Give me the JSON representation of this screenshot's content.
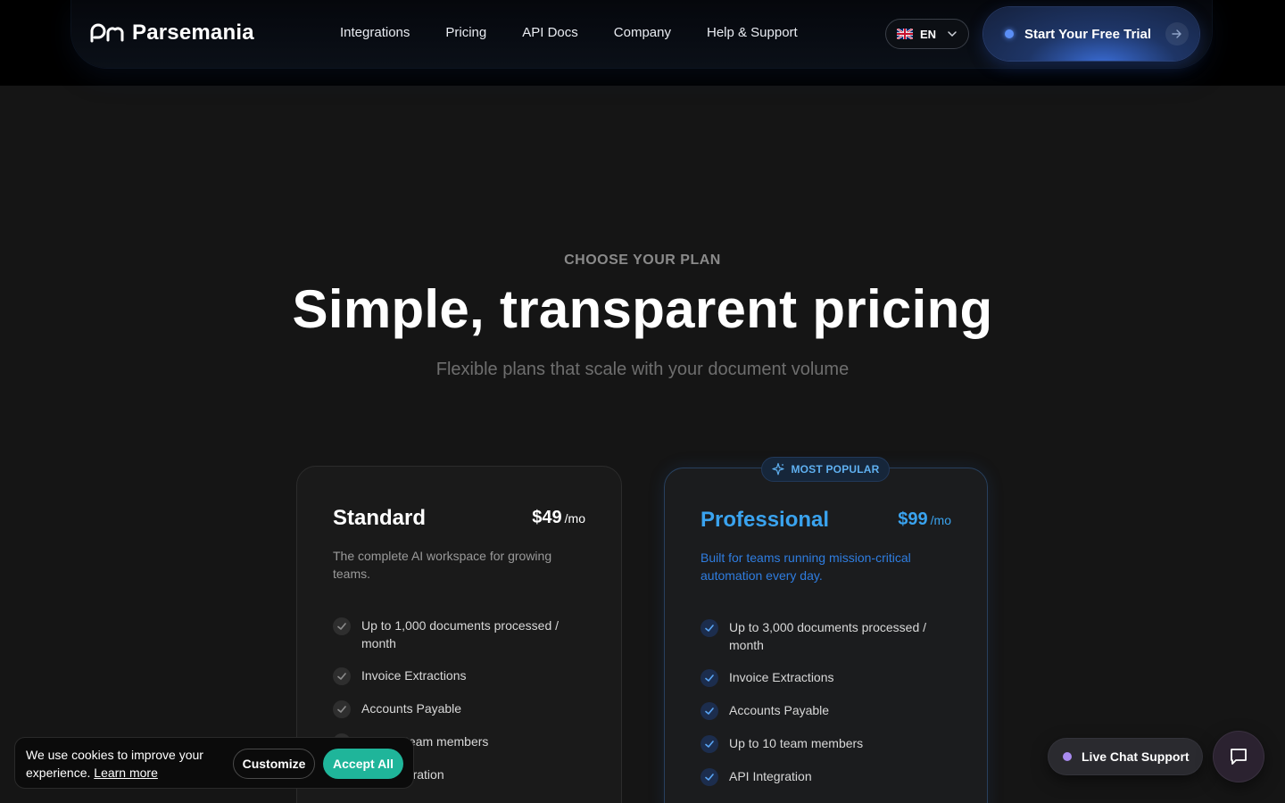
{
  "brand": {
    "name": "Parsemania",
    "logo_icon": "parsemania-logo-icon"
  },
  "nav": {
    "links": [
      "Integrations",
      "Pricing",
      "API Docs",
      "Company",
      "Help & Support"
    ],
    "language": {
      "code": "EN",
      "flag_icon": "uk-flag-icon"
    },
    "cta_label": "Start Your Free Trial"
  },
  "hero": {
    "eyebrow": "CHOOSE YOUR PLAN",
    "title": "Simple, transparent pricing",
    "subtitle": "Flexible plans that scale with your document volume"
  },
  "plans": [
    {
      "name": "Standard",
      "price": "$49",
      "period": "/mo",
      "description": "The complete AI workspace for growing teams.",
      "features": [
        "Up to 1,000 documents processed / month",
        "Invoice Extractions",
        "Accounts Payable",
        "Up to 5 team members",
        "API Integration"
      ]
    },
    {
      "name": "Professional",
      "price": "$99",
      "period": "/mo",
      "badge": "MOST POPULAR",
      "description": "Built for teams running mission-critical automation every day.",
      "features": [
        "Up to 3,000 documents processed / month",
        "Invoice Extractions",
        "Accounts Payable",
        "Up to 10 team members",
        "API Integration"
      ]
    }
  ],
  "cookie_banner": {
    "text": "We use cookies to improve your experience.",
    "learn_more": "Learn more",
    "customize_label": "Customize",
    "accept_label": "Accept All"
  },
  "support": {
    "live_chat_label": "Live Chat Support",
    "chat_icon": "chat-bubble-icon"
  },
  "colors": {
    "background": "#151515",
    "accent_blue": "#3aa3ef",
    "accept_green": "#1fb59a",
    "cta_blue": "#1e3566"
  }
}
